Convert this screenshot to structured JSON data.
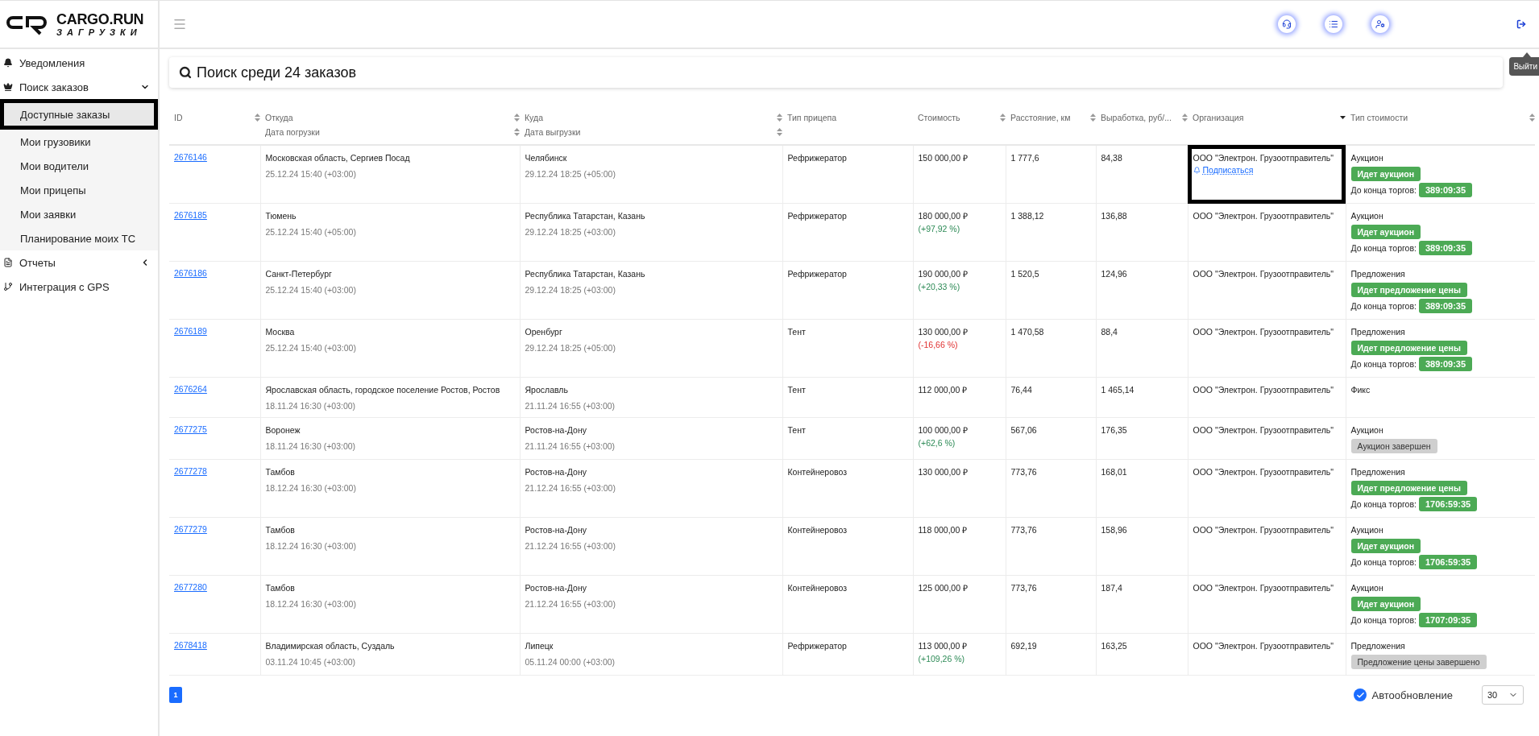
{
  "logo": {
    "title": "CARGO.RUN",
    "subtitle": "ЗАГРУЗКИ"
  },
  "sidebar": {
    "items": [
      {
        "label": "Уведомления",
        "kind": "bell",
        "selected": false
      },
      {
        "label": "Поиск заказов",
        "kind": "crown",
        "selected": false,
        "expanded": true,
        "children": [
          {
            "label": "Доступные заказы",
            "selected": true
          },
          {
            "label": "Мои грузовики",
            "selected": false
          },
          {
            "label": "Мои водители",
            "selected": false
          },
          {
            "label": "Мои прицепы",
            "selected": false
          },
          {
            "label": "Мои заявки",
            "selected": false
          },
          {
            "label": "Планирование моих ТС",
            "selected": false
          }
        ]
      },
      {
        "label": "Отчеты",
        "kind": "report",
        "selected": false,
        "expanded": false
      },
      {
        "label": "Интеграция с GPS",
        "kind": "branch",
        "selected": false
      }
    ]
  },
  "header": {
    "tooltip": "Выйти"
  },
  "search": {
    "title": "Поиск среди 24 заказов"
  },
  "table": {
    "columns": [
      {
        "label": "ID",
        "sortable": true
      },
      {
        "label": "Откуда",
        "sortable": true,
        "sub": {
          "label": "Дата погрузки",
          "sortable": true
        }
      },
      {
        "label": "Куда",
        "sortable": true,
        "sub": {
          "label": "Дата выгрузки",
          "sortable": true
        }
      },
      {
        "label": "Тип прицепа",
        "sortable": false
      },
      {
        "label": "Стоимость",
        "sortable": true
      },
      {
        "label": "Расстояние, км",
        "sortable": true
      },
      {
        "label": "Выработка, руб/...",
        "sortable": true
      },
      {
        "label": "Организация",
        "sortable": true,
        "sorted": true
      },
      {
        "label": "Тип стоимости",
        "sortable": true
      }
    ],
    "rows": [
      {
        "id": "2676146",
        "from": "Московская область, Сергиев Посад",
        "load_date": "25.12.24 15:40 (+03:00)",
        "to": "Челябинск",
        "unload_date": "29.12.24 18:25 (+05:00)",
        "trailer": "Рефрижератор",
        "price": "150 000,00 ₽",
        "distance": "1 777,6",
        "yield": "84,38",
        "organization": {
          "name": "ООО \"Электрон. Грузоотправитель\"",
          "subscribe": "Подписаться",
          "highlighted": true
        },
        "price_type": "Аукцион",
        "status": {
          "text": "Идет аукцион",
          "kind": "active"
        },
        "countdown": {
          "label": "До конца торгов:",
          "value": "389:09:35"
        }
      },
      {
        "id": "2676185",
        "from": "Тюмень",
        "load_date": "25.12.24 15:40 (+05:00)",
        "to": "Республика Татарстан, Казань",
        "unload_date": "29.12.24 18:25 (+03:00)",
        "trailer": "Рефрижератор",
        "price": "180 000,00 ₽",
        "change": {
          "text": "(+97,92 %)",
          "kind": "up"
        },
        "distance": "1 388,12",
        "yield": "136,88",
        "organization": {
          "name": "ООО \"Электрон. Грузоотправитель\"",
          "highlighted": false
        },
        "price_type": "Аукцион",
        "status": {
          "text": "Идет аукцион",
          "kind": "active"
        },
        "countdown": {
          "label": "До конца торгов:",
          "value": "389:09:35"
        }
      },
      {
        "id": "2676186",
        "from": "Санкт-Петербург",
        "load_date": "25.12.24 15:40 (+03:00)",
        "to": "Республика Татарстан, Казань",
        "unload_date": "29.12.24 18:25 (+03:00)",
        "trailer": "Рефрижератор",
        "price": "190 000,00 ₽",
        "change": {
          "text": "(+20,33 %)",
          "kind": "up"
        },
        "distance": "1 520,5",
        "yield": "124,96",
        "organization": {
          "name": "ООО \"Электрон. Грузоотправитель\"",
          "highlighted": false
        },
        "price_type": "Предложения",
        "status": {
          "text": "Идет предложение цены",
          "kind": "active"
        },
        "countdown": {
          "label": "До конца торгов:",
          "value": "389:09:35"
        }
      },
      {
        "id": "2676189",
        "from": "Москва",
        "load_date": "25.12.24 15:40 (+03:00)",
        "to": "Оренбург",
        "unload_date": "29.12.24 18:25 (+05:00)",
        "trailer": "Тент",
        "price": "130 000,00 ₽",
        "change": {
          "text": "(-16,66 %)",
          "kind": "down"
        },
        "distance": "1 470,58",
        "yield": "88,4",
        "organization": {
          "name": "ООО \"Электрон. Грузоотправитель\"",
          "highlighted": false
        },
        "price_type": "Предложения",
        "status": {
          "text": "Идет предложение цены",
          "kind": "active"
        },
        "countdown": {
          "label": "До конца торгов:",
          "value": "389:09:35"
        }
      },
      {
        "id": "2676264",
        "from": "Ярославская область, городское поселение Ростов, Ростов",
        "load_date": "18.11.24 16:30 (+03:00)",
        "to": "Ярославль",
        "unload_date": "21.11.24 16:55 (+03:00)",
        "trailer": "Тент",
        "price": "112 000,00 ₽",
        "distance": "76,44",
        "yield": "1 465,14",
        "organization": {
          "name": "ООО \"Электрон. Грузоотправитель\"",
          "highlighted": false
        },
        "price_type": "Фикс"
      },
      {
        "id": "2677275",
        "from": "Воронеж",
        "load_date": "18.11.24 16:30 (+03:00)",
        "to": "Ростов-на-Дону",
        "unload_date": "21.11.24 16:55 (+03:00)",
        "trailer": "Тент",
        "price": "100 000,00 ₽",
        "change": {
          "text": "(+62,6 %)",
          "kind": "up"
        },
        "distance": "567,06",
        "yield": "176,35",
        "organization": {
          "name": "ООО \"Электрон. Грузоотправитель\"",
          "highlighted": false
        },
        "price_type": "Аукцион",
        "status": {
          "text": "Аукцион завершен",
          "kind": "finished"
        }
      },
      {
        "id": "2677278",
        "from": "Тамбов",
        "load_date": "18.12.24 16:30 (+03:00)",
        "to": "Ростов-на-Дону",
        "unload_date": "21.12.24 16:55 (+03:00)",
        "trailer": "Контейнеровоз",
        "price": "130 000,00 ₽",
        "distance": "773,76",
        "yield": "168,01",
        "organization": {
          "name": "ООО \"Электрон. Грузоотправитель\"",
          "highlighted": false
        },
        "price_type": "Предложения",
        "status": {
          "text": "Идет предложение цены",
          "kind": "active"
        },
        "countdown": {
          "label": "До конца торгов:",
          "value": "1706:59:35"
        }
      },
      {
        "id": "2677279",
        "from": "Тамбов",
        "load_date": "18.12.24 16:30 (+03:00)",
        "to": "Ростов-на-Дону",
        "unload_date": "21.12.24 16:55 (+03:00)",
        "trailer": "Контейнеровоз",
        "price": "118 000,00 ₽",
        "distance": "773,76",
        "yield": "158,96",
        "organization": {
          "name": "ООО \"Электрон. Грузоотправитель\"",
          "highlighted": false
        },
        "price_type": "Аукцион",
        "status": {
          "text": "Идет аукцион",
          "kind": "active"
        },
        "countdown": {
          "label": "До конца торгов:",
          "value": "1706:59:35"
        }
      },
      {
        "id": "2677280",
        "from": "Тамбов",
        "load_date": "18.12.24 16:30 (+03:00)",
        "to": "Ростов-на-Дону",
        "unload_date": "21.12.24 16:55 (+03:00)",
        "trailer": "Контейнеровоз",
        "price": "125 000,00 ₽",
        "distance": "773,76",
        "yield": "187,4",
        "organization": {
          "name": "ООО \"Электрон. Грузоотправитель\"",
          "highlighted": false
        },
        "price_type": "Аукцион",
        "status": {
          "text": "Идет аукцион",
          "kind": "active"
        },
        "countdown": {
          "label": "До конца торгов:",
          "value": "1707:09:35"
        }
      },
      {
        "id": "2678418",
        "from": "Владимирская область, Суздаль",
        "load_date": "03.11.24 10:45 (+03:00)",
        "to": "Липецк",
        "unload_date": "05.11.24 00:00 (+03:00)",
        "trailer": "Рефрижератор",
        "price": "113 000,00 ₽",
        "change": {
          "text": "(+109,26 %)",
          "kind": "up"
        },
        "distance": "692,19",
        "yield": "163,25",
        "organization": {
          "name": "ООО \"Электрон. Грузоотправитель\"",
          "highlighted": false
        },
        "price_type": "Предложения",
        "status": {
          "text": "Предложение цены завершено",
          "kind": "finished"
        }
      }
    ]
  },
  "footer": {
    "pages": [
      {
        "label": "1",
        "selected": true
      }
    ],
    "auto_refresh": {
      "label": "Автообновление",
      "checked": true
    },
    "page_size": {
      "value": "30"
    }
  }
}
